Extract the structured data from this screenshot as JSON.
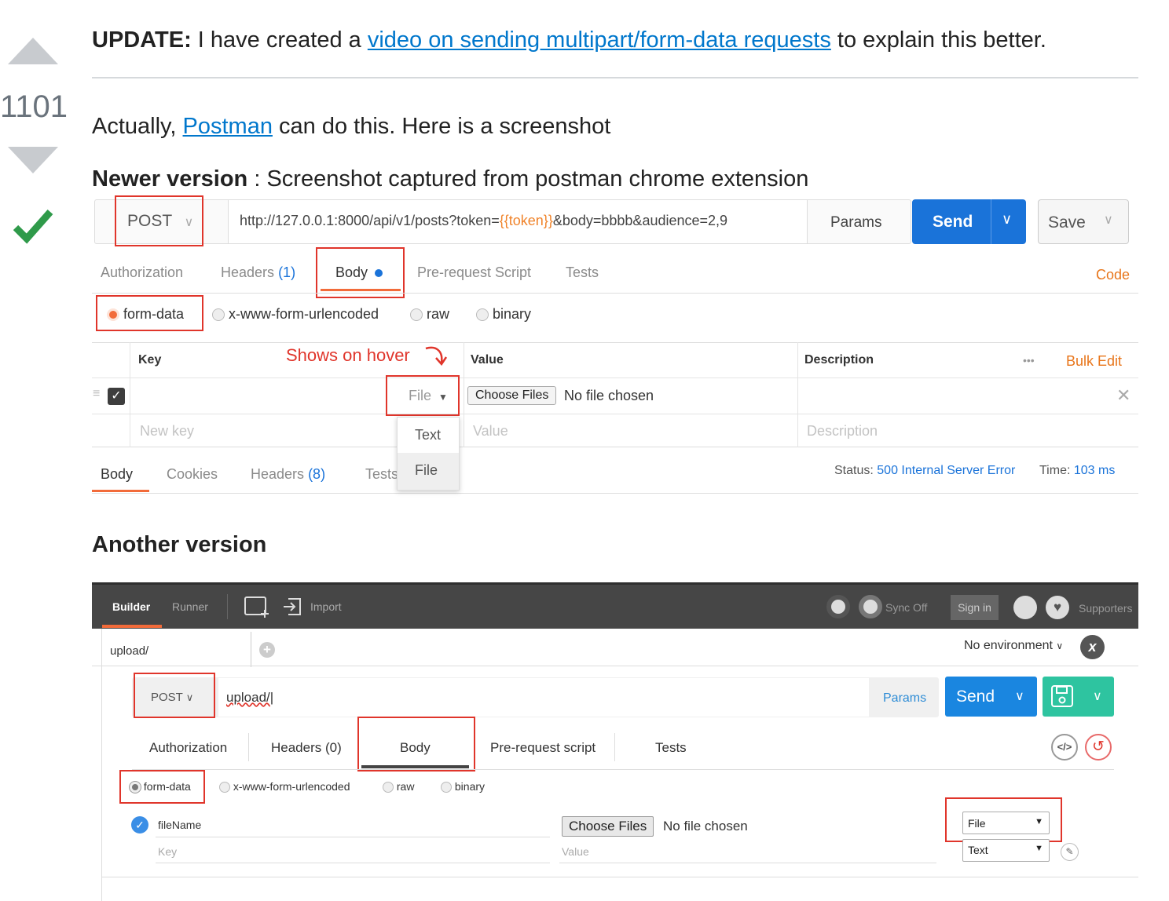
{
  "vote": {
    "count": "1101"
  },
  "update": {
    "bold": "UPDATE:",
    "pre": "I have created a",
    "link": "video on sending multipart/form-data requests",
    "post": "to explain this better."
  },
  "intro": {
    "pre": "Actually,",
    "link": "Postman",
    "post": "can do this. Here is a screenshot"
  },
  "newer": {
    "bold": "Newer version",
    "rest": ": Screenshot captured from postman chrome extension"
  },
  "another": {
    "title": "Another version"
  },
  "p1": {
    "method": "POST",
    "url_pre": "http://127.0.0.1:8000/api/v1/posts?token=",
    "url_var": "{{token}}",
    "url_post": "&body=bbbb&audience=2,9",
    "params": "Params",
    "send": "Send",
    "save": "Save",
    "tabs": {
      "authorization": "Authorization",
      "headers": "Headers",
      "headers_count": "(1)",
      "body": "Body",
      "prerequest": "Pre-request Script",
      "tests": "Tests",
      "code": "Code"
    },
    "body_types": {
      "formdata": "form-data",
      "urlencoded": "x-www-form-urlencoded",
      "raw": "raw",
      "binary": "binary"
    },
    "table": {
      "key": "Key",
      "value": "Value",
      "description": "Description",
      "bulk_edit": "Bulk Edit",
      "dots": "•••",
      "new_key": "New key",
      "value_ph": "Value",
      "desc_ph": "Description"
    },
    "hover_note": "Shows on hover",
    "type_select": "File",
    "dropdown": [
      "Text",
      "File"
    ],
    "choose_files": "Choose Files",
    "no_file": "No file chosen",
    "resp_tabs": {
      "body": "Body",
      "cookies": "Cookies",
      "headers": "Headers",
      "headers_count": "(8)",
      "tests": "Tests"
    },
    "status_label": "Status:",
    "status_value": "500 Internal Server Error",
    "time_label": "Time:",
    "time_value": "103 ms"
  },
  "p2": {
    "top": {
      "builder": "Builder",
      "runner": "Runner",
      "import": "Import",
      "sync": "Sync Off",
      "signin": "Sign in",
      "supporters": "Supporters"
    },
    "tab_name": "upload/",
    "environment": "No environment",
    "method": "POST",
    "url": "upload/",
    "params": "Params",
    "send": "Send",
    "tabs": {
      "authorization": "Authorization",
      "headers": "Headers (0)",
      "body": "Body",
      "prerequest": "Pre-request script",
      "tests": "Tests"
    },
    "body_types": {
      "formdata": "form-data",
      "urlencoded": "x-www-form-urlencoded",
      "raw": "raw",
      "binary": "binary"
    },
    "row_key": "fileName",
    "choose_files": "Choose Files",
    "no_file": "No file chosen",
    "key_ph": "Key",
    "value_ph": "Value",
    "type1": "File",
    "type2": "Text"
  }
}
